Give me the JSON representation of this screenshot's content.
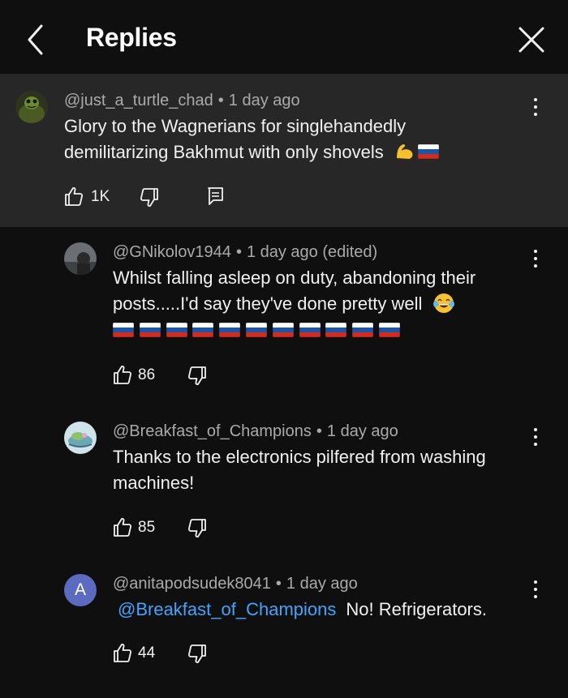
{
  "header": {
    "title": "Replies"
  },
  "comments": [
    {
      "author": "@just_a_turtle_chad",
      "time": "1 day ago",
      "text_line1": "Glory to the Wagnerians for singlehandedly",
      "text_line2": "demilitarizing Bakhmut with only shovels",
      "likes": "1K",
      "emoji": [
        "flexed-biceps",
        "russia-flag"
      ]
    },
    {
      "author": "@GNikolov1944",
      "time": "1 day ago (edited)",
      "text_line1": "Whilst falling asleep on duty, abandoning their",
      "text_line2": "posts.....I'd say they've done pretty well",
      "emoji": [
        "laughing-tears"
      ],
      "flag_count": 11,
      "likes": "86"
    },
    {
      "author": "@Breakfast_of_Champions",
      "time": "1 day ago",
      "text_line1": "Thanks to the electronics pilfered from washing",
      "text_line2": "machines!",
      "likes": "85"
    },
    {
      "author": "@anitapodsudek8041",
      "time": "1 day ago",
      "avatar_letter": "A",
      "mention": "@Breakfast_of_Champions",
      "text": "No! Refrigerators.",
      "likes": "44"
    }
  ],
  "colors": {
    "background": "#0f0f0f",
    "highlight": "#272727",
    "mention": "#3ea6ff",
    "avatar_a": "#5c6bc0"
  },
  "icons": [
    "back-chevron-icon",
    "close-icon",
    "thumbs-up-icon",
    "thumbs-down-icon",
    "reply-icon",
    "more-vert-icon"
  ]
}
